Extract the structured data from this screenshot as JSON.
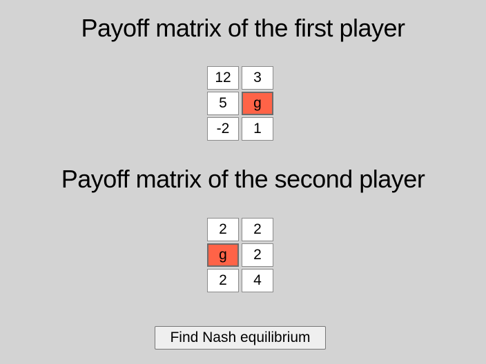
{
  "first_player": {
    "title": "Payoff matrix of the first player",
    "cells": [
      {
        "value": "12",
        "highlight": false
      },
      {
        "value": "3",
        "highlight": false
      },
      {
        "value": "5",
        "highlight": false
      },
      {
        "value": "g",
        "highlight": true
      },
      {
        "value": "-2",
        "highlight": false
      },
      {
        "value": "1",
        "highlight": false
      }
    ]
  },
  "second_player": {
    "title": "Payoff matrix of the second player",
    "cells": [
      {
        "value": "2",
        "highlight": false
      },
      {
        "value": "2",
        "highlight": false
      },
      {
        "value": "g",
        "highlight": true
      },
      {
        "value": "2",
        "highlight": false
      },
      {
        "value": "2",
        "highlight": false
      },
      {
        "value": "4",
        "highlight": false
      }
    ]
  },
  "find_button_label": "Find Nash equilibrium",
  "colors": {
    "background": "#d3d3d3",
    "highlight": "#ff6347"
  }
}
